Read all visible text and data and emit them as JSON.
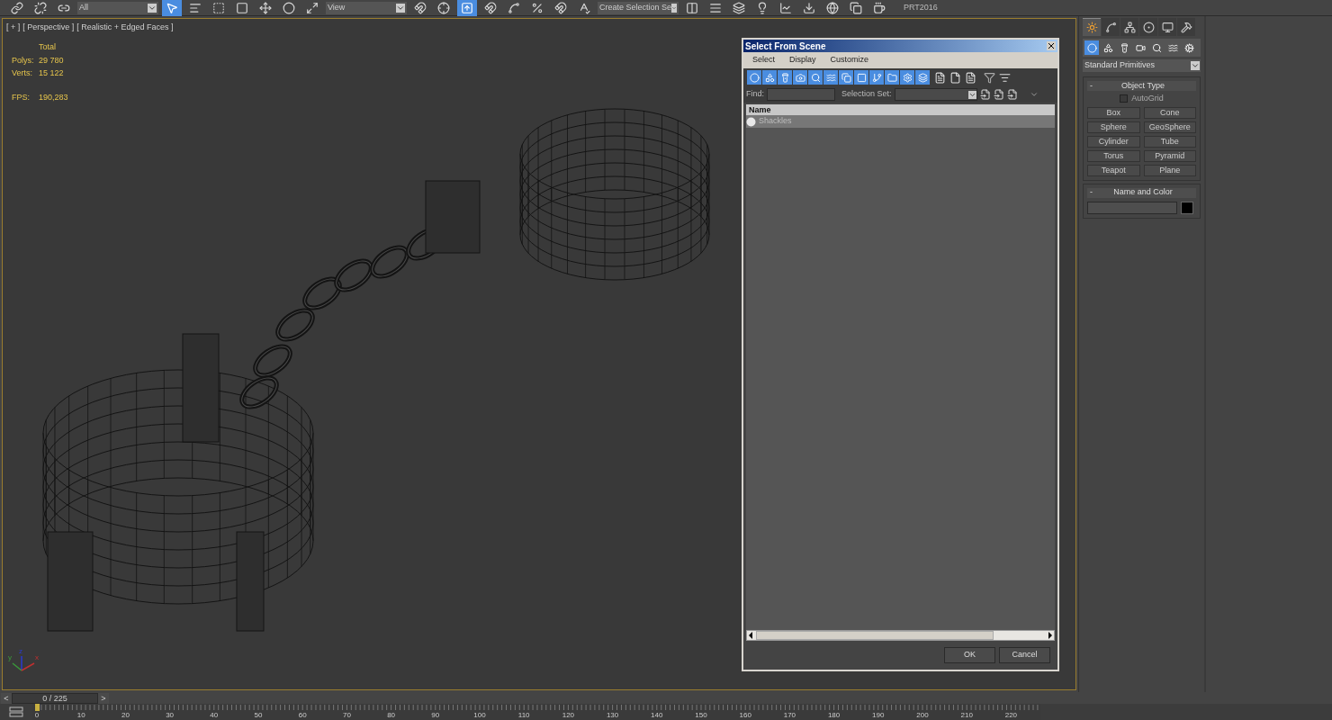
{
  "toolbar": {
    "items": [
      {
        "kind": "icon",
        "selected": false
      },
      {
        "kind": "icon",
        "selected": false
      },
      {
        "kind": "icon",
        "selected": false
      },
      {
        "kind": "dropdown",
        "text": "All"
      },
      {
        "kind": "icon",
        "selected": true
      },
      {
        "kind": "icon",
        "selected": false
      },
      {
        "kind": "icon",
        "selected": false
      },
      {
        "kind": "icon",
        "selected": false
      },
      {
        "kind": "icon",
        "selected": false
      },
      {
        "kind": "icon",
        "selected": false
      },
      {
        "kind": "icon",
        "selected": false
      },
      {
        "kind": "dropdown",
        "text": "View"
      },
      {
        "kind": "icon",
        "selected": false
      },
      {
        "kind": "icon",
        "selected": false
      },
      {
        "kind": "icon",
        "selected": true
      },
      {
        "kind": "icon",
        "selected": false
      },
      {
        "kind": "icon",
        "selected": false
      },
      {
        "kind": "icon",
        "selected": false
      },
      {
        "kind": "icon",
        "selected": false
      },
      {
        "kind": "icon",
        "selected": false
      },
      {
        "kind": "dropdown",
        "text": "Create Selection Se"
      },
      {
        "kind": "icon",
        "selected": false
      },
      {
        "kind": "icon",
        "selected": false
      },
      {
        "kind": "icon",
        "selected": false
      },
      {
        "kind": "icon",
        "selected": false
      },
      {
        "kind": "icon",
        "selected": false
      },
      {
        "kind": "icon",
        "selected": false
      },
      {
        "kind": "icon",
        "selected": false
      },
      {
        "kind": "icon",
        "selected": false
      },
      {
        "kind": "icon",
        "selected": false
      },
      {
        "kind": "label",
        "text": "PRT2016"
      }
    ]
  },
  "viewport": {
    "labels": [
      "[ + ]",
      "[ Perspective ]",
      "[ Realistic + Edged Faces ]"
    ],
    "stats": {
      "header": "Total",
      "rows": [
        {
          "label": "Polys:",
          "value": "29 780"
        },
        {
          "label": "Verts:",
          "value": "15 122"
        }
      ],
      "fps": {
        "label": "FPS:",
        "value": "190,283"
      }
    },
    "axes": [
      "y",
      "z",
      "x"
    ]
  },
  "dialog": {
    "title": "Select From Scene",
    "menu": [
      "Select",
      "Display",
      "Customize"
    ],
    "type_filters": [
      {
        "selected": true
      },
      {
        "selected": true
      },
      {
        "selected": true
      },
      {
        "selected": true
      },
      {
        "selected": true
      },
      {
        "selected": true
      },
      {
        "selected": true
      },
      {
        "selected": true
      },
      {
        "selected": true
      },
      {
        "selected": true
      },
      {
        "selected": true
      },
      {
        "selected": true
      }
    ],
    "find_label": "Find:",
    "selection_set_label": "Selection Set:",
    "list": {
      "header": "Name",
      "rows": [
        {
          "name": "Shackles",
          "selected": true
        }
      ]
    },
    "buttons": [
      "OK",
      "Cancel"
    ]
  },
  "command_panel": {
    "tabs": [
      {
        "selected": true
      },
      {
        "selected": false
      },
      {
        "selected": false
      },
      {
        "selected": false
      },
      {
        "selected": false
      },
      {
        "selected": false
      }
    ],
    "categories": [
      {
        "selected": true
      },
      {
        "selected": false
      },
      {
        "selected": false
      },
      {
        "selected": false
      },
      {
        "selected": false
      },
      {
        "selected": false
      },
      {
        "selected": false
      }
    ],
    "dropdown": "Standard Primitives",
    "object_type": {
      "collapse_sign": "-",
      "title": "Object Type",
      "autogrid": {
        "label": "AutoGrid",
        "checked": false
      },
      "buttons": [
        "Box",
        "Cone",
        "Sphere",
        "GeoSphere",
        "Cylinder",
        "Tube",
        "Torus",
        "Pyramid",
        "Teapot",
        "Plane"
      ]
    },
    "name_and_color": {
      "collapse_sign": "-",
      "title": "Name and Color",
      "color": "#000000"
    }
  },
  "timeline": {
    "prev": "<",
    "frame": "0 / 225",
    "next": ">",
    "ruler_labels": [
      "0",
      "10",
      "20",
      "30",
      "40",
      "50",
      "60",
      "70",
      "80",
      "90",
      "100",
      "110",
      "120",
      "130",
      "140",
      "150",
      "160",
      "170",
      "180",
      "190",
      "200",
      "210",
      "220"
    ]
  }
}
